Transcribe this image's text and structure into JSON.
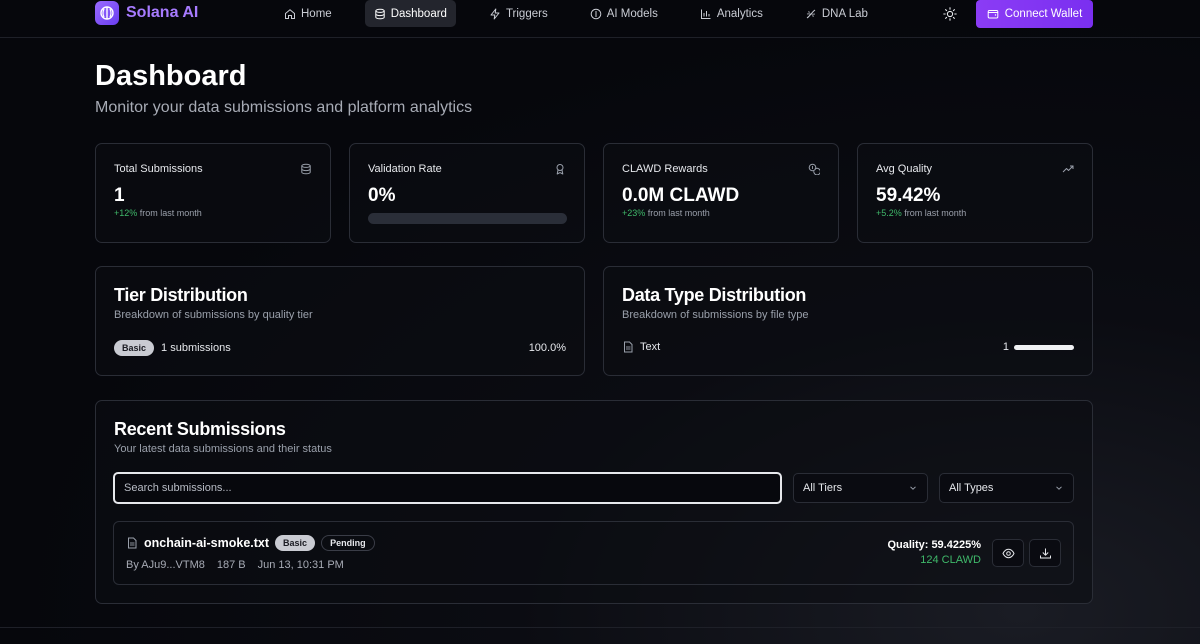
{
  "brand": {
    "name": "Solana AI"
  },
  "nav": {
    "items": [
      {
        "label": "Home",
        "icon": "home-icon",
        "active": false
      },
      {
        "label": "Dashboard",
        "icon": "database-icon",
        "active": true
      },
      {
        "label": "Triggers",
        "icon": "zap-icon",
        "active": false
      },
      {
        "label": "AI Models",
        "icon": "info-circle-icon",
        "active": false
      },
      {
        "label": "Analytics",
        "icon": "bar-chart-icon",
        "active": false
      },
      {
        "label": "DNA Lab",
        "icon": "dna-icon",
        "active": false
      }
    ],
    "connect_label": "Connect Wallet"
  },
  "header": {
    "title": "Dashboard",
    "subtitle": "Monitor your data submissions and platform analytics"
  },
  "stats": [
    {
      "label": "Total Submissions",
      "value": "1",
      "change": "+12%",
      "change_suffix": "from last month",
      "icon": "database-icon"
    },
    {
      "label": "Validation Rate",
      "value": "0%",
      "progress": 0,
      "icon": "award-icon"
    },
    {
      "label": "CLAWD Rewards",
      "value": "0.0M CLAWD",
      "change": "+23%",
      "change_suffix": "from last month",
      "icon": "coins-icon"
    },
    {
      "label": "Avg Quality",
      "value": "59.42%",
      "change": "+5.2%",
      "change_suffix": "from last month",
      "icon": "trending-up-icon"
    }
  ],
  "tier": {
    "title": "Tier Distribution",
    "subtitle": "Breakdown of submissions by quality tier",
    "badge": "Basic",
    "count": "1 submissions",
    "percent": "100.0%"
  },
  "types": {
    "title": "Data Type Distribution",
    "subtitle": "Breakdown of submissions by file type",
    "label": "Text",
    "count": "1",
    "fraction": 1.0
  },
  "recent": {
    "title": "Recent Submissions",
    "subtitle": "Your latest data submissions and their status",
    "search_placeholder": "Search submissions...",
    "tier_filter": "All Tiers",
    "type_filter": "All Types",
    "items": [
      {
        "file": "onchain-ai-smoke.txt",
        "tier": "Basic",
        "status": "Pending",
        "by": "By AJu9...VTM8",
        "size": "187 B",
        "date": "Jun 13, 10:31 PM",
        "quality": "Quality: 59.4225%",
        "reward": "124 CLAWD"
      }
    ]
  },
  "colors": {
    "accent": "#8b3cf5",
    "brand": "#a77bff",
    "positive": "#3fb86a",
    "background": "#06070c"
  }
}
